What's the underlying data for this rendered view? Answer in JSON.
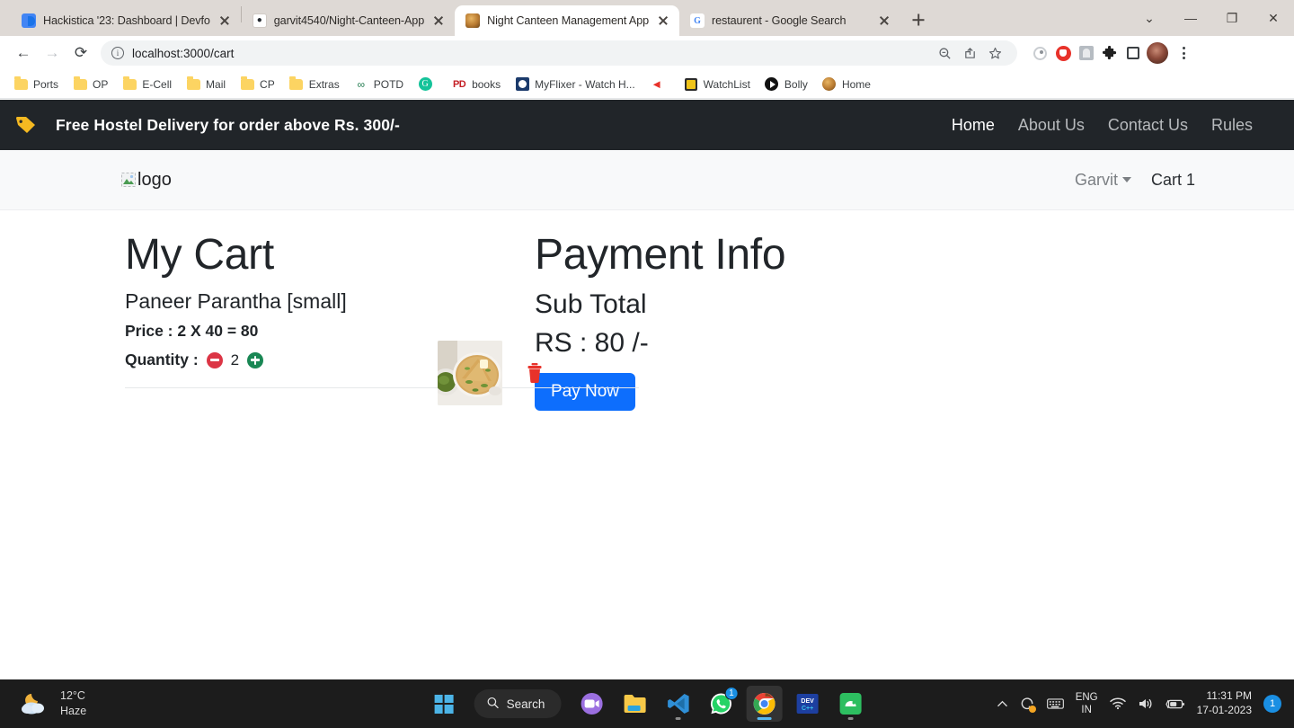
{
  "browser": {
    "tabs": [
      {
        "title": "Hackistica '23: Dashboard | Devfo",
        "favicon": "devfolio-icon",
        "active": false
      },
      {
        "title": "garvit4540/Night-Canteen-App",
        "favicon": "github-icon",
        "active": false
      },
      {
        "title": "Night Canteen Management App",
        "favicon": "canteen-icon",
        "active": true
      },
      {
        "title": "restaurent - Google Search",
        "favicon": "google-icon",
        "active": false
      }
    ],
    "new_tab_label": "+",
    "window_controls": {
      "tab_search": "⌄",
      "minimize": "—",
      "maximize": "❐",
      "close": "✕"
    },
    "nav": {
      "back": "←",
      "forward": "→",
      "reload": "⟳"
    },
    "omnibox": {
      "url_host": "localhost",
      "url_path": ":3000/cart",
      "full_url": "localhost:3000/cart",
      "info_icon": "ⓘ",
      "zoom_icon": "⚲",
      "share_icon": "↗",
      "bookmark_icon": "☆"
    },
    "extensions": [
      "extension-ring-icon",
      "adblock-icon",
      "gray-extension-icon",
      "puzzle-icon",
      "side-panel-icon"
    ],
    "profile": "profile-avatar",
    "menu": "kebab-menu",
    "bookmarks": [
      {
        "label": "Ports",
        "icon": "folder-icon"
      },
      {
        "label": "OP",
        "icon": "folder-icon"
      },
      {
        "label": "E-Cell",
        "icon": "folder-icon"
      },
      {
        "label": "Mail",
        "icon": "folder-icon"
      },
      {
        "label": "CP",
        "icon": "folder-icon"
      },
      {
        "label": "Extras",
        "icon": "folder-icon"
      },
      {
        "label": "POTD",
        "icon": "link-icon"
      },
      {
        "label": "",
        "icon": "grammarly-icon"
      },
      {
        "label": "books",
        "icon": "pd-icon"
      },
      {
        "label": "MyFlixer - Watch H...",
        "icon": "myflixer-icon"
      },
      {
        "label": "",
        "icon": "red-arrow-icon"
      },
      {
        "label": "WatchList",
        "icon": "watchlist-icon"
      },
      {
        "label": "Bolly",
        "icon": "play-icon"
      },
      {
        "label": "Home",
        "icon": "canteen-icon"
      }
    ]
  },
  "page": {
    "promo": {
      "icon": "tag-icon",
      "text": "Free Hostel Delivery for order above Rs. 300/-",
      "nav": [
        {
          "label": "Home",
          "active": true
        },
        {
          "label": "About Us",
          "active": false
        },
        {
          "label": "Contact Us",
          "active": false
        },
        {
          "label": "Rules",
          "active": false
        }
      ]
    },
    "header": {
      "logo_alt": "logo",
      "user_name": "Garvit",
      "cart_label": "Cart 1"
    },
    "cart": {
      "title": "My Cart",
      "items": [
        {
          "name": "Paneer Parantha [small]",
          "price_label": "Price : 2 X 40 = 80",
          "quantity_label": "Quantity :",
          "quantity": "2",
          "decrease_icon": "minus-circle-icon",
          "increase_icon": "plus-circle-icon",
          "delete_icon": "trash-icon",
          "image_alt": "paneer-parantha-thumbnail"
        }
      ]
    },
    "payment": {
      "title": "Payment Info",
      "subtotal_label": "Sub Total",
      "amount": "RS : 80 /-",
      "pay_button": "Pay Now"
    }
  },
  "taskbar": {
    "weather": {
      "temperature": "12°C",
      "condition": "Haze",
      "icon": "moon-cloud-icon"
    },
    "start_label": "start-button",
    "search_label": "Search",
    "apps": [
      {
        "name": "teams-icon",
        "badge": "",
        "active": false
      },
      {
        "name": "file-explorer-icon",
        "badge": "",
        "active": false
      },
      {
        "name": "vscode-icon",
        "badge": "",
        "active": false
      },
      {
        "name": "whatsapp-icon",
        "badge": "1",
        "active": false
      },
      {
        "name": "chrome-icon",
        "badge": "",
        "active": true
      },
      {
        "name": "dev-icon",
        "badge": "",
        "active": false
      },
      {
        "name": "evernote-icon",
        "badge": "",
        "active": false
      }
    ],
    "tray": {
      "chevron": "⌃",
      "sync_icon": "sync-icon",
      "keyboard_icon": "keyboard-icon",
      "language": "ENG",
      "region": "IN",
      "wifi_icon": "wifi-icon",
      "volume_icon": "volume-icon",
      "battery_icon": "battery-icon",
      "time": "11:31 PM",
      "date": "17-01-2023",
      "notification_count": "1"
    }
  },
  "colors": {
    "promo_bg": "#212529",
    "pay_button": "#0d6efd",
    "minus": "#dc3545",
    "plus": "#198754",
    "trash": "#e8322a"
  }
}
